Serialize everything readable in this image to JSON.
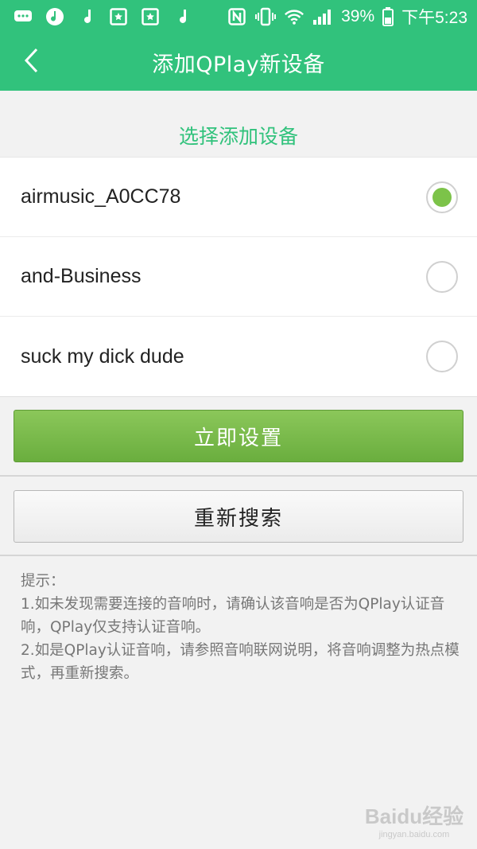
{
  "status_bar": {
    "battery_percent": "39%",
    "time": "下午5:23",
    "left_icons": [
      "message-icon",
      "music-note-icon",
      "music-note-icon",
      "photo-icon",
      "photo-icon",
      "music-note-icon"
    ],
    "right_icons": [
      "nfc-icon",
      "vibrate-icon",
      "wifi-icon",
      "signal-icon",
      "battery-icon"
    ]
  },
  "app_bar": {
    "title": "添加QPlay新设备",
    "back_icon": "chevron-left-icon"
  },
  "device_section": {
    "heading": "选择添加设备",
    "devices": [
      {
        "name": "airmusic_A0CC78",
        "selected": true
      },
      {
        "name": "and-Business",
        "selected": false
      },
      {
        "name": "suck my dick dude",
        "selected": false
      }
    ]
  },
  "actions": {
    "setup_label": "立即设置",
    "rescan_label": "重新搜索"
  },
  "tips": {
    "title": "提示：",
    "line1": "1.如未发现需要连接的音响时，请确认该音响是否为QPlay认证音响，QPlay仅支持认证音响。",
    "line2": "2.如是QPlay认证音响，请参照音响联网说明，将音响调整为热点模式，再重新搜索。"
  },
  "watermark": {
    "brand": "Baidu经验",
    "url": "jingyan.baidu.com"
  },
  "colors": {
    "accent": "#31c27c",
    "button_green": "#7cc349",
    "tip_text": "#777777"
  }
}
